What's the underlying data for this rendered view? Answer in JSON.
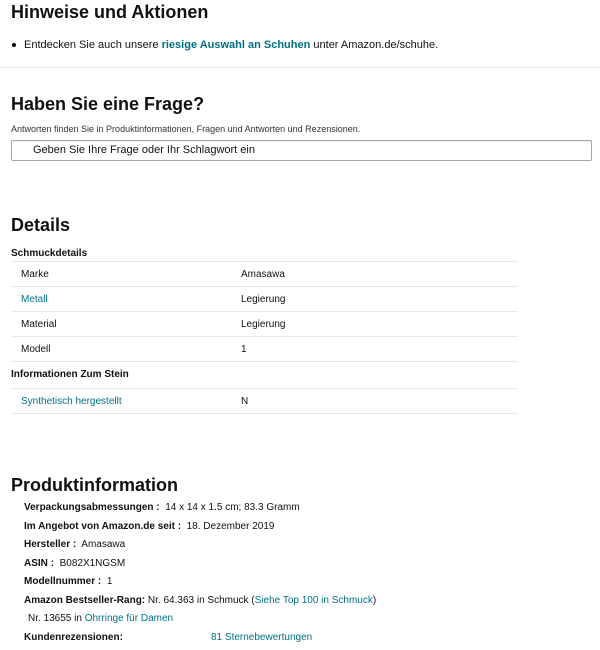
{
  "hinweise": {
    "title": "Hinweise und Aktionen",
    "bullet_pre": "Entdecken Sie auch unsere ",
    "bullet_link": "riesige Auswahl an Schuhen",
    "bullet_post": " unter Amazon.de/schuhe."
  },
  "frage": {
    "title": "Haben Sie eine Frage?",
    "subtitle": "Antworten finden Sie in Produktinformationen, Fragen und Antworten und Rezensionen.",
    "placeholder": "Geben Sie Ihre Frage oder Ihr Schlagwort ein"
  },
  "details": {
    "title": "Details",
    "section1_title": "Schmuckdetails",
    "section1_rows": [
      {
        "key": "Marke",
        "value": "Amasawa"
      },
      {
        "key": "Metall",
        "value": "Legierung"
      },
      {
        "key": "Material",
        "value": "Legierung"
      },
      {
        "key": "Modell",
        "value": "1"
      }
    ],
    "section2_title": "Informationen Zum Stein",
    "section2_rows": [
      {
        "key": "Synthetisch hergestellt",
        "value": "N"
      }
    ]
  },
  "produkt": {
    "title": "Produktinformation",
    "verpackung_key": "Verpackungsabmessungen",
    "verpackung_val": "14 x 14 x 1.5 cm; 83.3 Gramm",
    "angebot_key": "Im Angebot von Amazon.de seit",
    "angebot_val": "18. Dezember 2019",
    "hersteller_key": "Hersteller",
    "hersteller_val": "Amasawa",
    "asin_key": "ASIN",
    "asin_val": "B082X1NGSM",
    "modell_key": "Modellnummer",
    "modell_val": "1",
    "rang_key": "Amazon Bestseller-Rang:",
    "rang_val": "Nr. 64.363 in Schmuck (",
    "rang_link": "Siehe Top 100 in Schmuck",
    "rang_close": ")",
    "rang2_pre": "Nr. 13655 in ",
    "rang2_link": "Ohrringe für Damen",
    "reviews_key": "Kundenrezensionen:",
    "reviews_val": "81 Sternebewertungen"
  },
  "colors": {
    "link": "#007185",
    "divider": "#e7e7e7"
  }
}
